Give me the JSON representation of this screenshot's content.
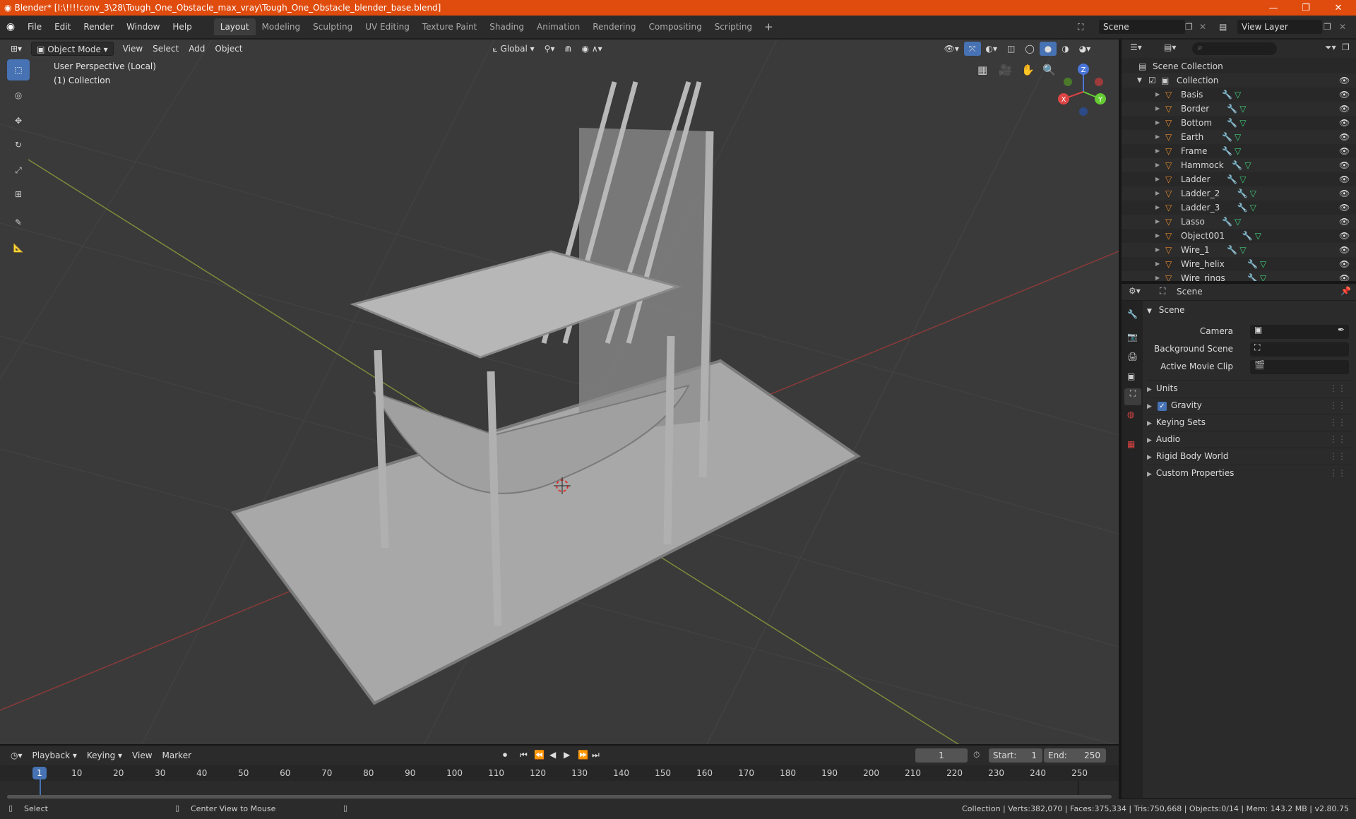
{
  "window": {
    "title": "Blender* [I:\\!!!!conv_3\\28\\Tough_One_Obstacle_max_vray\\Tough_One_Obstacle_blender_base.blend]",
    "controls": [
      "minimize-icon",
      "maximize-icon",
      "close-icon"
    ]
  },
  "menubar": {
    "items": [
      "File",
      "Edit",
      "Render",
      "Window",
      "Help"
    ],
    "workspaces": [
      "Layout",
      "Modeling",
      "Sculpting",
      "UV Editing",
      "Texture Paint",
      "Shading",
      "Animation",
      "Rendering",
      "Compositing",
      "Scripting"
    ],
    "active_workspace": "Layout",
    "scene": "Scene",
    "view_layer": "View Layer"
  },
  "viewport": {
    "mode": "Object Mode",
    "menus": [
      "View",
      "Select",
      "Add",
      "Object"
    ],
    "orientation": "Global",
    "info_line1": "User Perspective (Local)",
    "info_line2": "(1) Collection",
    "gizmo": {
      "x": "X",
      "y": "Y",
      "z": "Z"
    }
  },
  "outliner": {
    "root": "Scene Collection",
    "collection": "Collection",
    "objects": [
      "Basis",
      "Border",
      "Bottom",
      "Earth",
      "Frame",
      "Hammock",
      "Ladder",
      "Ladder_2",
      "Ladder_3",
      "Lasso",
      "Object001",
      "Wire_1",
      "Wire_helix",
      "Wire_rings"
    ]
  },
  "properties": {
    "context": "Scene",
    "panel_title": "Scene",
    "fields": [
      {
        "label": "Camera",
        "value": ""
      },
      {
        "label": "Background Scene",
        "value": ""
      },
      {
        "label": "Active Movie Clip",
        "value": ""
      }
    ],
    "panels": [
      "Units",
      "Gravity",
      "Keying Sets",
      "Audio",
      "Rigid Body World",
      "Custom Properties"
    ],
    "gravity_checked": true
  },
  "timeline": {
    "menus": [
      "Playback",
      "Keying",
      "View",
      "Marker"
    ],
    "current_frame": "1",
    "start_label": "Start:",
    "start": "1",
    "end_label": "End:",
    "end": "250",
    "ticks": [
      "10",
      "20",
      "30",
      "40",
      "50",
      "60",
      "70",
      "80",
      "90",
      "100",
      "110",
      "120",
      "130",
      "140",
      "150",
      "160",
      "170",
      "180",
      "190",
      "200",
      "210",
      "220",
      "230",
      "240",
      "250"
    ],
    "playhead": "1"
  },
  "statusbar": {
    "left": "Select",
    "middle": "Center View to Mouse",
    "right": "Collection | Verts:382,070 | Faces:375,334 | Tris:750,668 | Objects:0/14 | Mem: 143.2 MB | v2.80.75"
  },
  "colors": {
    "accent": "#4772b3",
    "titlebar": "#e04c0e",
    "object_icon": "#e88a2a",
    "mesh_icon": "#3fd07a",
    "modifier_icon": "#6aa3e8"
  }
}
